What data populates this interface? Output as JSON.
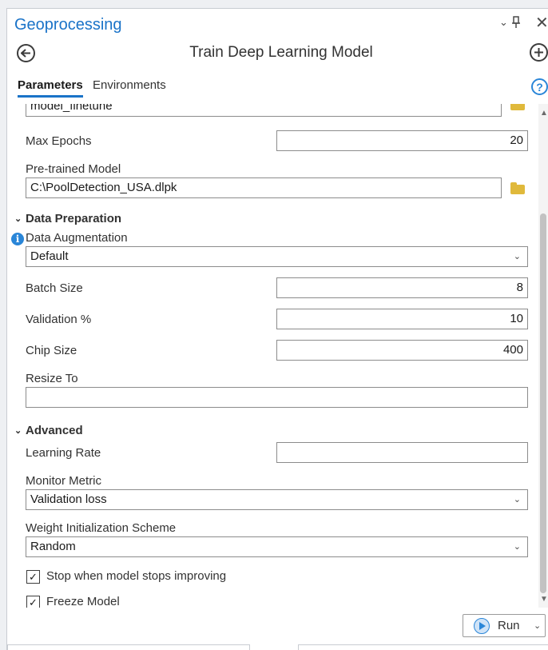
{
  "pane": {
    "title": "Geoprocessing",
    "chevron": "⌄",
    "pin": "📌",
    "close": "✕"
  },
  "tool": {
    "title": "Train Deep Learning Model",
    "back_icon": "back-arrow-icon",
    "add_icon": "add-icon"
  },
  "tabs": [
    {
      "label": "Parameters",
      "active": true
    },
    {
      "label": "Environments",
      "active": false
    }
  ],
  "help_glyph": "?",
  "params": {
    "partial_value": "model_finetune",
    "max_epochs": {
      "label": "Max Epochs",
      "value": "20"
    },
    "pretrained": {
      "label": "Pre-trained Model",
      "value": "C:\\PoolDetection_USA.dlpk"
    },
    "data_prep": {
      "section": "Data Preparation",
      "augmentation": {
        "label": "Data Augmentation",
        "value": "Default"
      },
      "batch_size": {
        "label": "Batch Size",
        "value": "8"
      },
      "validation": {
        "label": "Validation %",
        "value": "10"
      },
      "chip_size": {
        "label": "Chip Size",
        "value": "400"
      },
      "resize_to": {
        "label": "Resize To",
        "value": ""
      }
    },
    "advanced": {
      "section": "Advanced",
      "learning_rate": {
        "label": "Learning Rate",
        "value": ""
      },
      "monitor_metric": {
        "label": "Monitor Metric",
        "value": "Validation loss"
      },
      "weight_init": {
        "label": "Weight Initialization Scheme",
        "value": "Random"
      },
      "stop_improving": {
        "label": "Stop when model stops improving",
        "checked": true
      },
      "freeze_model": {
        "label": "Freeze Model",
        "checked": true
      }
    }
  },
  "run": {
    "label": "Run"
  },
  "glyphs": {
    "check": "✓",
    "dropdown": "⌄",
    "info": "i"
  }
}
